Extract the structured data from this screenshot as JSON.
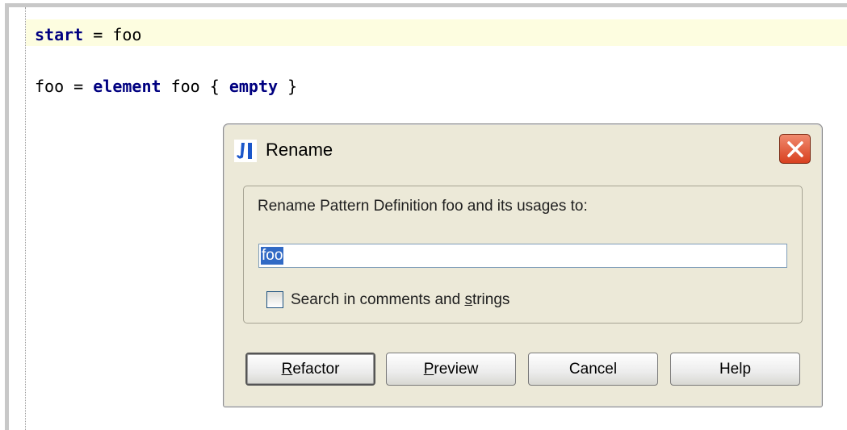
{
  "editor": {
    "line1": {
      "kw": "start",
      "rest": " = foo"
    },
    "line2": {
      "pre": "foo = ",
      "kw1": "element",
      "mid": " foo { ",
      "kw2": "empty",
      "post": " }"
    }
  },
  "dialog": {
    "title": "Rename",
    "prompt": "Rename Pattern Definition foo and its usages to:",
    "name_value": "foo",
    "checkbox_label_pre": "Search in comments and ",
    "checkbox_label_u": "s",
    "checkbox_label_post": "trings",
    "buttons": {
      "refactor_u": "R",
      "refactor_rest": "efactor",
      "preview_u": "P",
      "preview_rest": "review",
      "cancel": "Cancel",
      "help": "Help"
    }
  }
}
